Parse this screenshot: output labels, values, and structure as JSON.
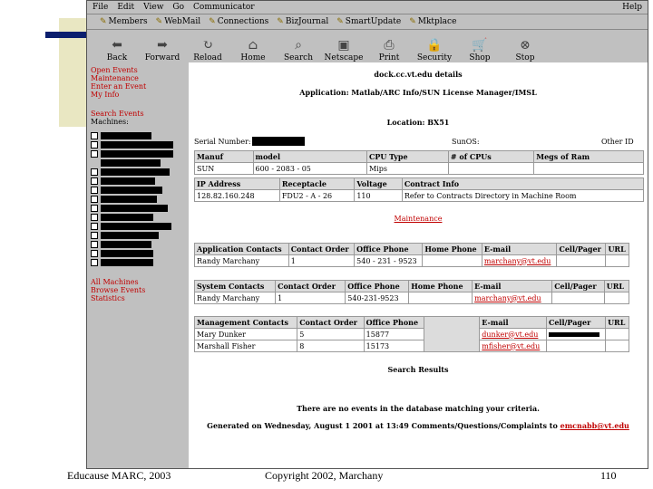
{
  "menu": [
    "File",
    "Edit",
    "View",
    "Go",
    "Communicator"
  ],
  "menu_help": "Help",
  "bookmarks": [
    "Members",
    "WebMail",
    "Connections",
    "BizJournal",
    "SmartUpdate",
    "Mktplace"
  ],
  "toolbar": [
    {
      "label": "Back",
      "icon": "back-arrow-icon",
      "glyph": "⬅"
    },
    {
      "label": "Forward",
      "icon": "forward-arrow-icon",
      "glyph": "➡"
    },
    {
      "label": "Reload",
      "icon": "reload-icon",
      "glyph": "↻"
    },
    {
      "label": "Home",
      "icon": "home-icon",
      "glyph": "⌂"
    },
    {
      "label": "Search",
      "icon": "search-icon",
      "glyph": "⌕"
    },
    {
      "label": "Netscape",
      "icon": "netscape-icon",
      "glyph": "▣"
    },
    {
      "label": "Print",
      "icon": "printer-icon",
      "glyph": "⎙"
    },
    {
      "label": "Security",
      "icon": "lock-icon",
      "glyph": "🔒"
    },
    {
      "label": "Shop",
      "icon": "shop-icon",
      "glyph": "🛒"
    },
    {
      "label": "Stop",
      "icon": "stop-icon",
      "glyph": "⊗"
    }
  ],
  "sidebar": {
    "links_top": [
      "Open Events",
      "Maintenance",
      "Enter an Event",
      "My Info"
    ],
    "search_link": "Search Events",
    "machines_label": "Machines:",
    "links_bottom": [
      "All Machines",
      "Browse Events",
      "Statistics"
    ]
  },
  "page": {
    "host_details": "dock.cc.vt.edu details",
    "application": "Application: Matlab/ARC Info/SUN License Manager/IMSL",
    "location": "Location: BX51",
    "serial_label": "Serial Number:",
    "os_label": "SunOS:",
    "other_label": "Other ID",
    "hw_headers": [
      "Manuf",
      "model",
      "CPU Type",
      "# of CPUs",
      "Megs of Ram"
    ],
    "hw_row": [
      "SUN",
      "600 - 2083 - 05",
      "Mips",
      "",
      ""
    ],
    "net_headers": [
      "IP Address",
      "Receptacle",
      "Voltage",
      "Contract Info"
    ],
    "net_row": [
      "128.82.160.248",
      "FDU2 - A - 26",
      "110",
      "Refer to Contracts Directory in Machine Room"
    ],
    "maintenance_link": "Maintenance",
    "app_contacts_headers": [
      "Application Contacts",
      "Contact Order",
      "Office Phone",
      "Home Phone",
      "E-mail",
      "Cell/Pager",
      "URL"
    ],
    "app_contacts_row": [
      "Randy Marchany",
      "1",
      "540 - 231 - 9523",
      "",
      "marchany@vt.edu",
      "",
      ""
    ],
    "sys_contacts_headers": [
      "System Contacts",
      "Contact Order",
      "Office Phone",
      "Home Phone",
      "E-mail",
      "Cell/Pager",
      "URL"
    ],
    "sys_contacts_row": [
      "Randy Marchany",
      "1",
      "540-231-9523",
      "",
      "marchany@vt.edu",
      "",
      ""
    ],
    "mgmt_headers": [
      "Management Contacts",
      "Contact Order",
      "Office Phone",
      "",
      "E-mail",
      "Cell/Pager",
      "URL"
    ],
    "mgmt_rows": [
      [
        "Mary Dunker",
        "5",
        "15877",
        "",
        "dunker@vt.edu",
        "",
        ""
      ],
      [
        "Marshall Fisher",
        "8",
        "15173",
        "",
        "mfisher@vt.edu",
        "",
        ""
      ]
    ],
    "search_results": "Search Results",
    "no_events": "There are no events in the database matching your criteria.",
    "generated": "Generated on Wednesday, August 1 2001 at 13:49 Comments/Questions/Complaints to",
    "generated_email": "emcnabb@vt.edu"
  },
  "footer": {
    "left": "Educause MARC, 2003",
    "center": "Copyright 2002, Marchany",
    "right": "110"
  },
  "colors": {
    "link": "#c00000",
    "accent_bar": "#0b1f6e",
    "deco_box": "#e9e7c2"
  }
}
